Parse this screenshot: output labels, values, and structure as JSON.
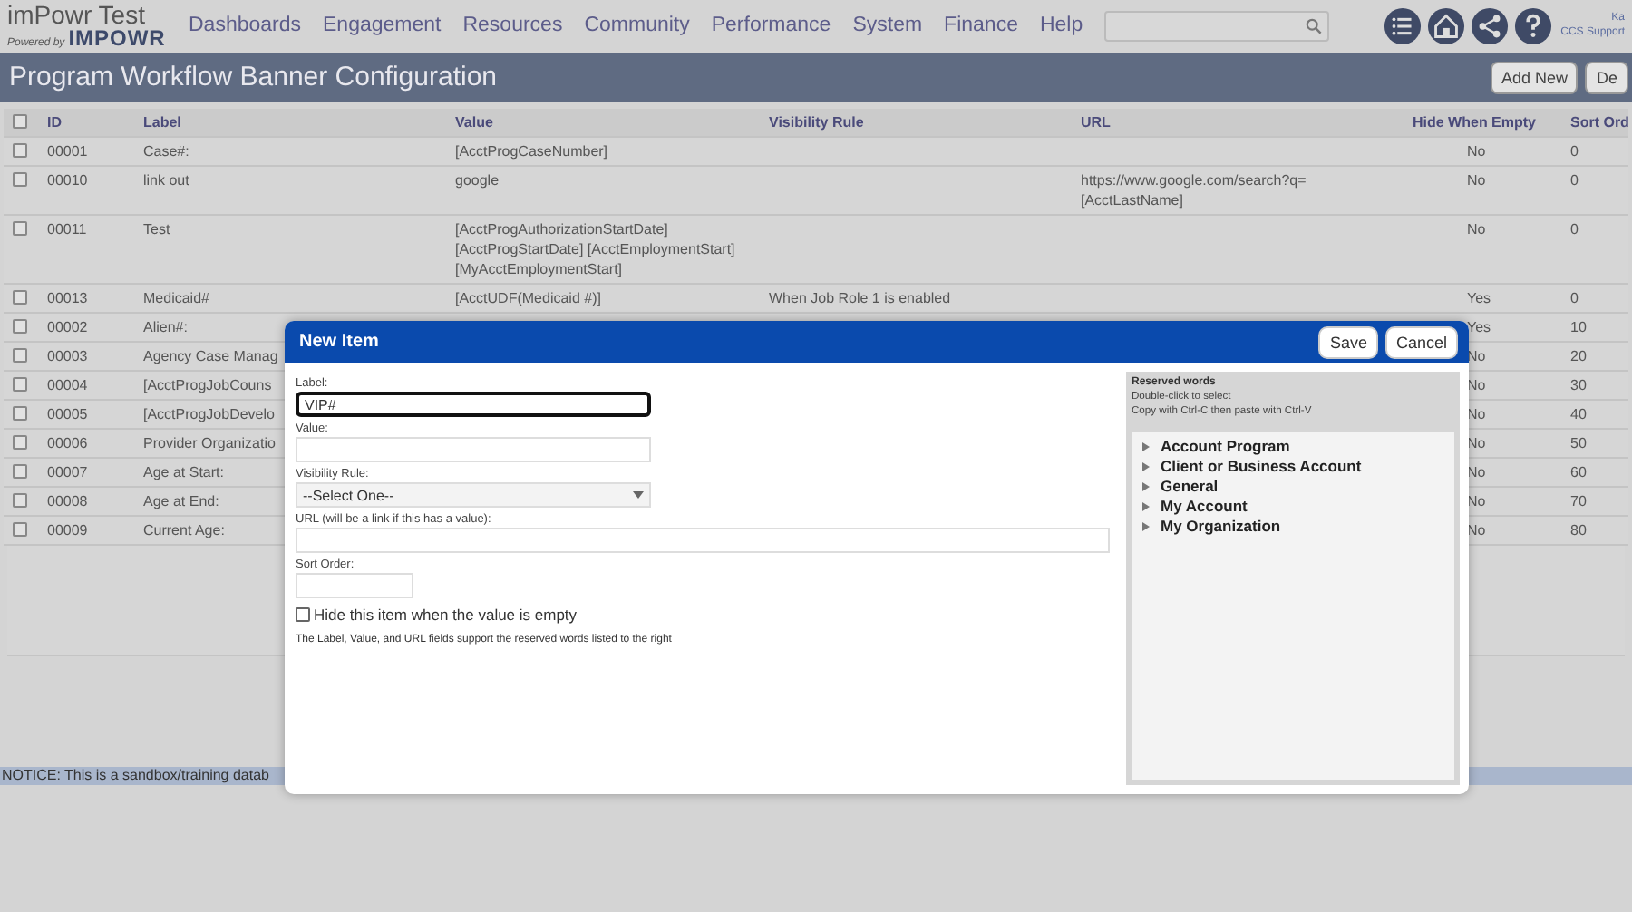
{
  "header": {
    "brand": "imPowr Test",
    "powered_by": "Powered by",
    "logo": "IMPOWR",
    "nav": [
      {
        "label": "Dashboards"
      },
      {
        "label": "Engagement"
      },
      {
        "label": "Resources"
      },
      {
        "label": "Community"
      },
      {
        "label": "Performance"
      },
      {
        "label": "System"
      },
      {
        "label": "Finance"
      },
      {
        "label": "Help"
      }
    ],
    "user": "Ka",
    "org": "CCS Support"
  },
  "title_bar": {
    "title": "Program Workflow Banner Configuration",
    "buttons": [
      "Add New",
      "De"
    ]
  },
  "table": {
    "columns": [
      "ID",
      "Label",
      "Value",
      "Visibility Rule",
      "URL",
      "Hide When Empty",
      "Sort Ord"
    ],
    "all_checked": false,
    "rows": [
      {
        "checked": false,
        "id": "00001",
        "label": "Case#:",
        "value": "[AcctProgCaseNumber]",
        "hide": "No",
        "sort": "0"
      },
      {
        "checked": false,
        "id": "00010",
        "label": "link out",
        "value": "google",
        "url": "https://www.google.com/search?q=[AcctLastName]",
        "hide": "No",
        "sort": "0"
      },
      {
        "checked": false,
        "id": "00011",
        "label": "Test",
        "value": "[AcctProgAuthorizationStartDate] [AcctProgStartDate] [AcctEmploymentStart] [MyAcctEmploymentStart]",
        "hide": "No",
        "sort": "0"
      },
      {
        "checked": false,
        "id": "00013",
        "label": "Medicaid#",
        "value": "[AcctUDF(Medicaid #)]",
        "rule": "When Job Role 1 is enabled",
        "hide": "Yes",
        "sort": "0"
      },
      {
        "checked": false,
        "id": "00002",
        "label": "Alien#:",
        "hide": "Yes",
        "sort": "10"
      },
      {
        "checked": false,
        "id": "00003",
        "label": "Agency Case Manag",
        "hide": "No",
        "sort": "20"
      },
      {
        "checked": false,
        "id": "00004",
        "label": "[AcctProgJobCouns",
        "hide": "No",
        "sort": "30"
      },
      {
        "checked": false,
        "id": "00005",
        "label": "[AcctProgJobDevelo",
        "hide": "No",
        "sort": "40"
      },
      {
        "checked": false,
        "id": "00006",
        "label": "Provider Organizatio",
        "hide": "No",
        "sort": "50"
      },
      {
        "checked": false,
        "id": "00007",
        "label": "Age at Start:",
        "hide": "No",
        "sort": "60"
      },
      {
        "checked": false,
        "id": "00008",
        "label": "Age at End:",
        "hide": "No",
        "sort": "70"
      },
      {
        "checked": false,
        "id": "00009",
        "label": "Current Age:",
        "hide": "No",
        "sort": "80"
      }
    ]
  },
  "notice": "NOTICE: This is a sandbox/training datab",
  "dialog": {
    "title": "New Item",
    "buttons": [
      "Save",
      "Cancel"
    ],
    "fields": [
      {
        "kind": "text",
        "label": "Label:",
        "value": "VIP#",
        "focused": true
      },
      {
        "kind": "text",
        "label": "Value:",
        "focused": false
      },
      {
        "kind": "select",
        "label": "Visibility Rule:",
        "value": "--Select One--",
        "focused": false
      },
      {
        "kind": "url",
        "label": "URL (will be a link if this has a value):",
        "focused": false
      },
      {
        "kind": "number",
        "label": "Sort Order:",
        "focused": false
      }
    ],
    "checkbox": {
      "label": "Hide this item when the value is empty",
      "checked": false
    },
    "note": "The Label, Value, and URL fields support the reserved words listed to the right",
    "reserved": {
      "title": "Reserved words",
      "hints": [
        "Double-click to select",
        "Copy with Ctrl-C then paste with Ctrl-V"
      ],
      "groups": [
        {
          "label": "Account Program",
          "expanded": false
        },
        {
          "label": "Client or Business Account",
          "expanded": false
        },
        {
          "label": "General",
          "expanded": false
        },
        {
          "label": "My Account",
          "expanded": false
        },
        {
          "label": "My Organization",
          "expanded": false
        }
      ]
    }
  }
}
